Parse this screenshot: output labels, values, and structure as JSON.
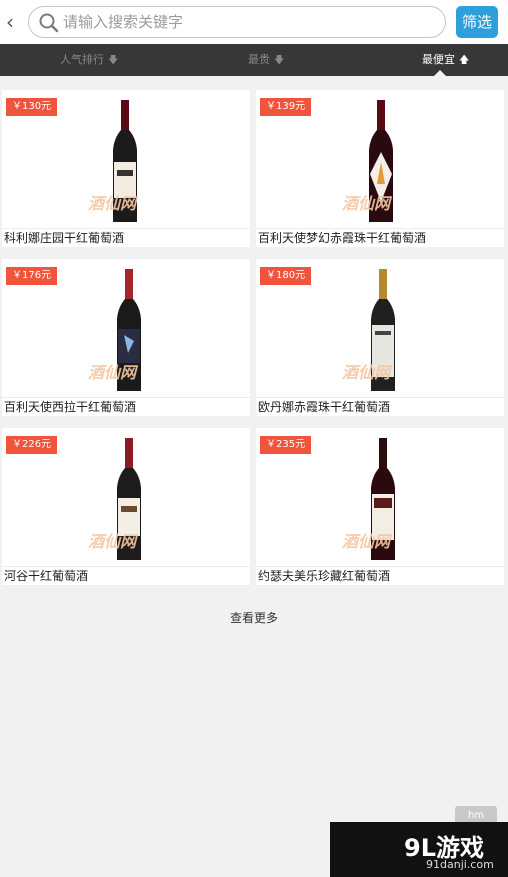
{
  "header": {
    "back_icon": "chevron-left-icon",
    "search": {
      "placeholder": "请输入搜索关键字",
      "icon": "search-icon"
    },
    "filter_label": "筛选",
    "accent": "#2f9fdc"
  },
  "sort": {
    "items": [
      {
        "label": "人气排行",
        "direction": "desc",
        "active": false
      },
      {
        "label": "最贵",
        "direction": "desc",
        "active": false
      },
      {
        "label": "最便宜",
        "direction": "asc",
        "active": true
      }
    ]
  },
  "products": [
    {
      "price": "￥130元",
      "name": "科利娜庄园干红葡萄酒",
      "watermark": "酒仙网"
    },
    {
      "price": "￥139元",
      "name": "百利天使梦幻赤霞珠干红葡萄酒",
      "watermark": "酒仙网"
    },
    {
      "price": "￥176元",
      "name": "百利天使西拉干红葡萄酒",
      "watermark": "酒仙网"
    },
    {
      "price": "￥180元",
      "name": "欧丹娜赤霞珠干红葡萄酒",
      "watermark": "酒仙网"
    },
    {
      "price": "￥226元",
      "name": "河谷干红葡萄酒",
      "watermark": "酒仙网"
    },
    {
      "price": "￥235元",
      "name": "约瑟夫美乐珍藏红葡萄酒",
      "watermark": "酒仙网"
    }
  ],
  "load_more": "查看更多",
  "overlay": {
    "logo": "9L游戏",
    "url": "91danji.com",
    "corner": "hm"
  },
  "colors": {
    "price_tag": "#f0543c",
    "sortbar": "#373737",
    "background": "#f1f1f1"
  }
}
